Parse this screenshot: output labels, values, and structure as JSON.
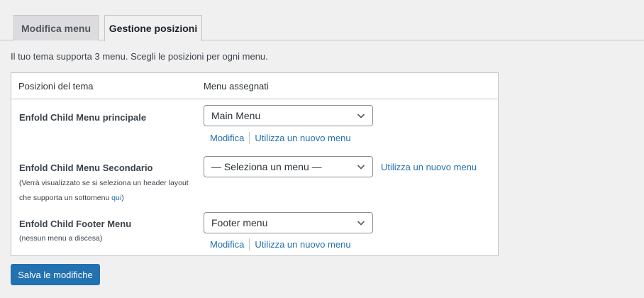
{
  "tabs": [
    {
      "label": "Modifica menu",
      "active": false
    },
    {
      "label": "Gestione posizioni",
      "active": true
    }
  ],
  "intro": "Il tuo tema supporta 3 menu. Scegli le posizioni per ogni menu.",
  "table": {
    "headers": {
      "location": "Posizioni del tema",
      "assigned": "Menu assegnati"
    },
    "rows": [
      {
        "title": "Enfold Child Menu principale",
        "selected": "Main Menu",
        "links": [
          "Modifica",
          "Utilizza un nuovo menu"
        ]
      },
      {
        "title": "Enfold Child Menu Secondario",
        "desc_prefix": "(Verrà visualizzato se si seleziona un header layout che supporta un sottomenu ",
        "desc_link": "qui",
        "desc_suffix": ")",
        "selected": "— Seleziona un menu —",
        "links": [
          "Utilizza un nuovo menu"
        ]
      },
      {
        "title": "Enfold Child Footer Menu",
        "desc": "(nessun menu a discesa)",
        "selected": "Footer menu",
        "links": [
          "Modifica",
          "Utilizza un nuovo menu"
        ]
      }
    ]
  },
  "save_button": "Salva le modifiche",
  "colors": {
    "accent": "#2271b1",
    "background": "#f0f0f1",
    "border": "#c3c4c7"
  },
  "icons": {
    "dropdown": "chevron-down-icon"
  }
}
